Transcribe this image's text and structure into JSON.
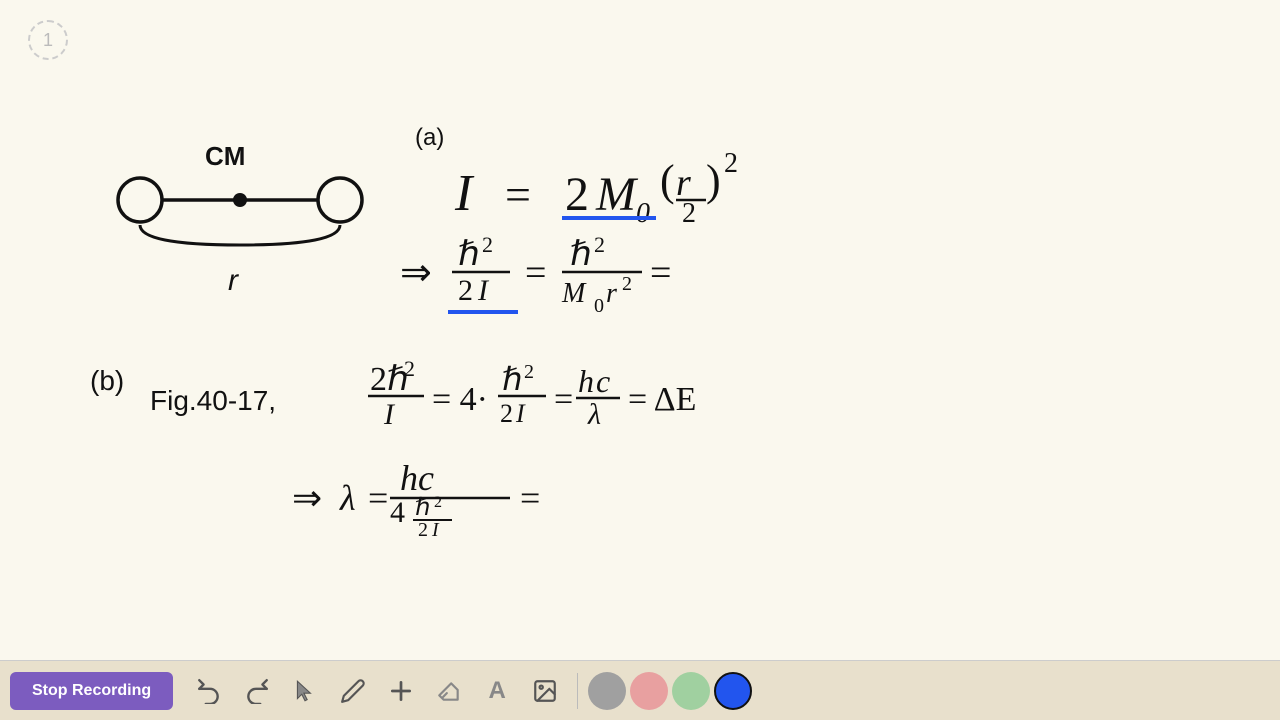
{
  "page": {
    "number": "1",
    "background": "#faf8ee"
  },
  "toolbar": {
    "stop_recording_label": "Stop Recording",
    "tools": [
      {
        "name": "undo",
        "icon": "↩",
        "label": "Undo"
      },
      {
        "name": "redo",
        "icon": "↪",
        "label": "Redo"
      },
      {
        "name": "select",
        "icon": "▲",
        "label": "Select"
      },
      {
        "name": "pen",
        "icon": "✏",
        "label": "Pen"
      },
      {
        "name": "add",
        "icon": "+",
        "label": "Add"
      },
      {
        "name": "eraser",
        "icon": "◻",
        "label": "Eraser"
      },
      {
        "name": "text",
        "icon": "A",
        "label": "Text"
      },
      {
        "name": "image",
        "icon": "🖼",
        "label": "Image"
      }
    ],
    "colors": [
      {
        "name": "gray",
        "hex": "#a0a0a0",
        "active": false
      },
      {
        "name": "pink",
        "hex": "#e8a0a0",
        "active": false
      },
      {
        "name": "green",
        "hex": "#a0d0a0",
        "active": false
      },
      {
        "name": "blue",
        "hex": "#2255ee",
        "active": true
      }
    ]
  }
}
